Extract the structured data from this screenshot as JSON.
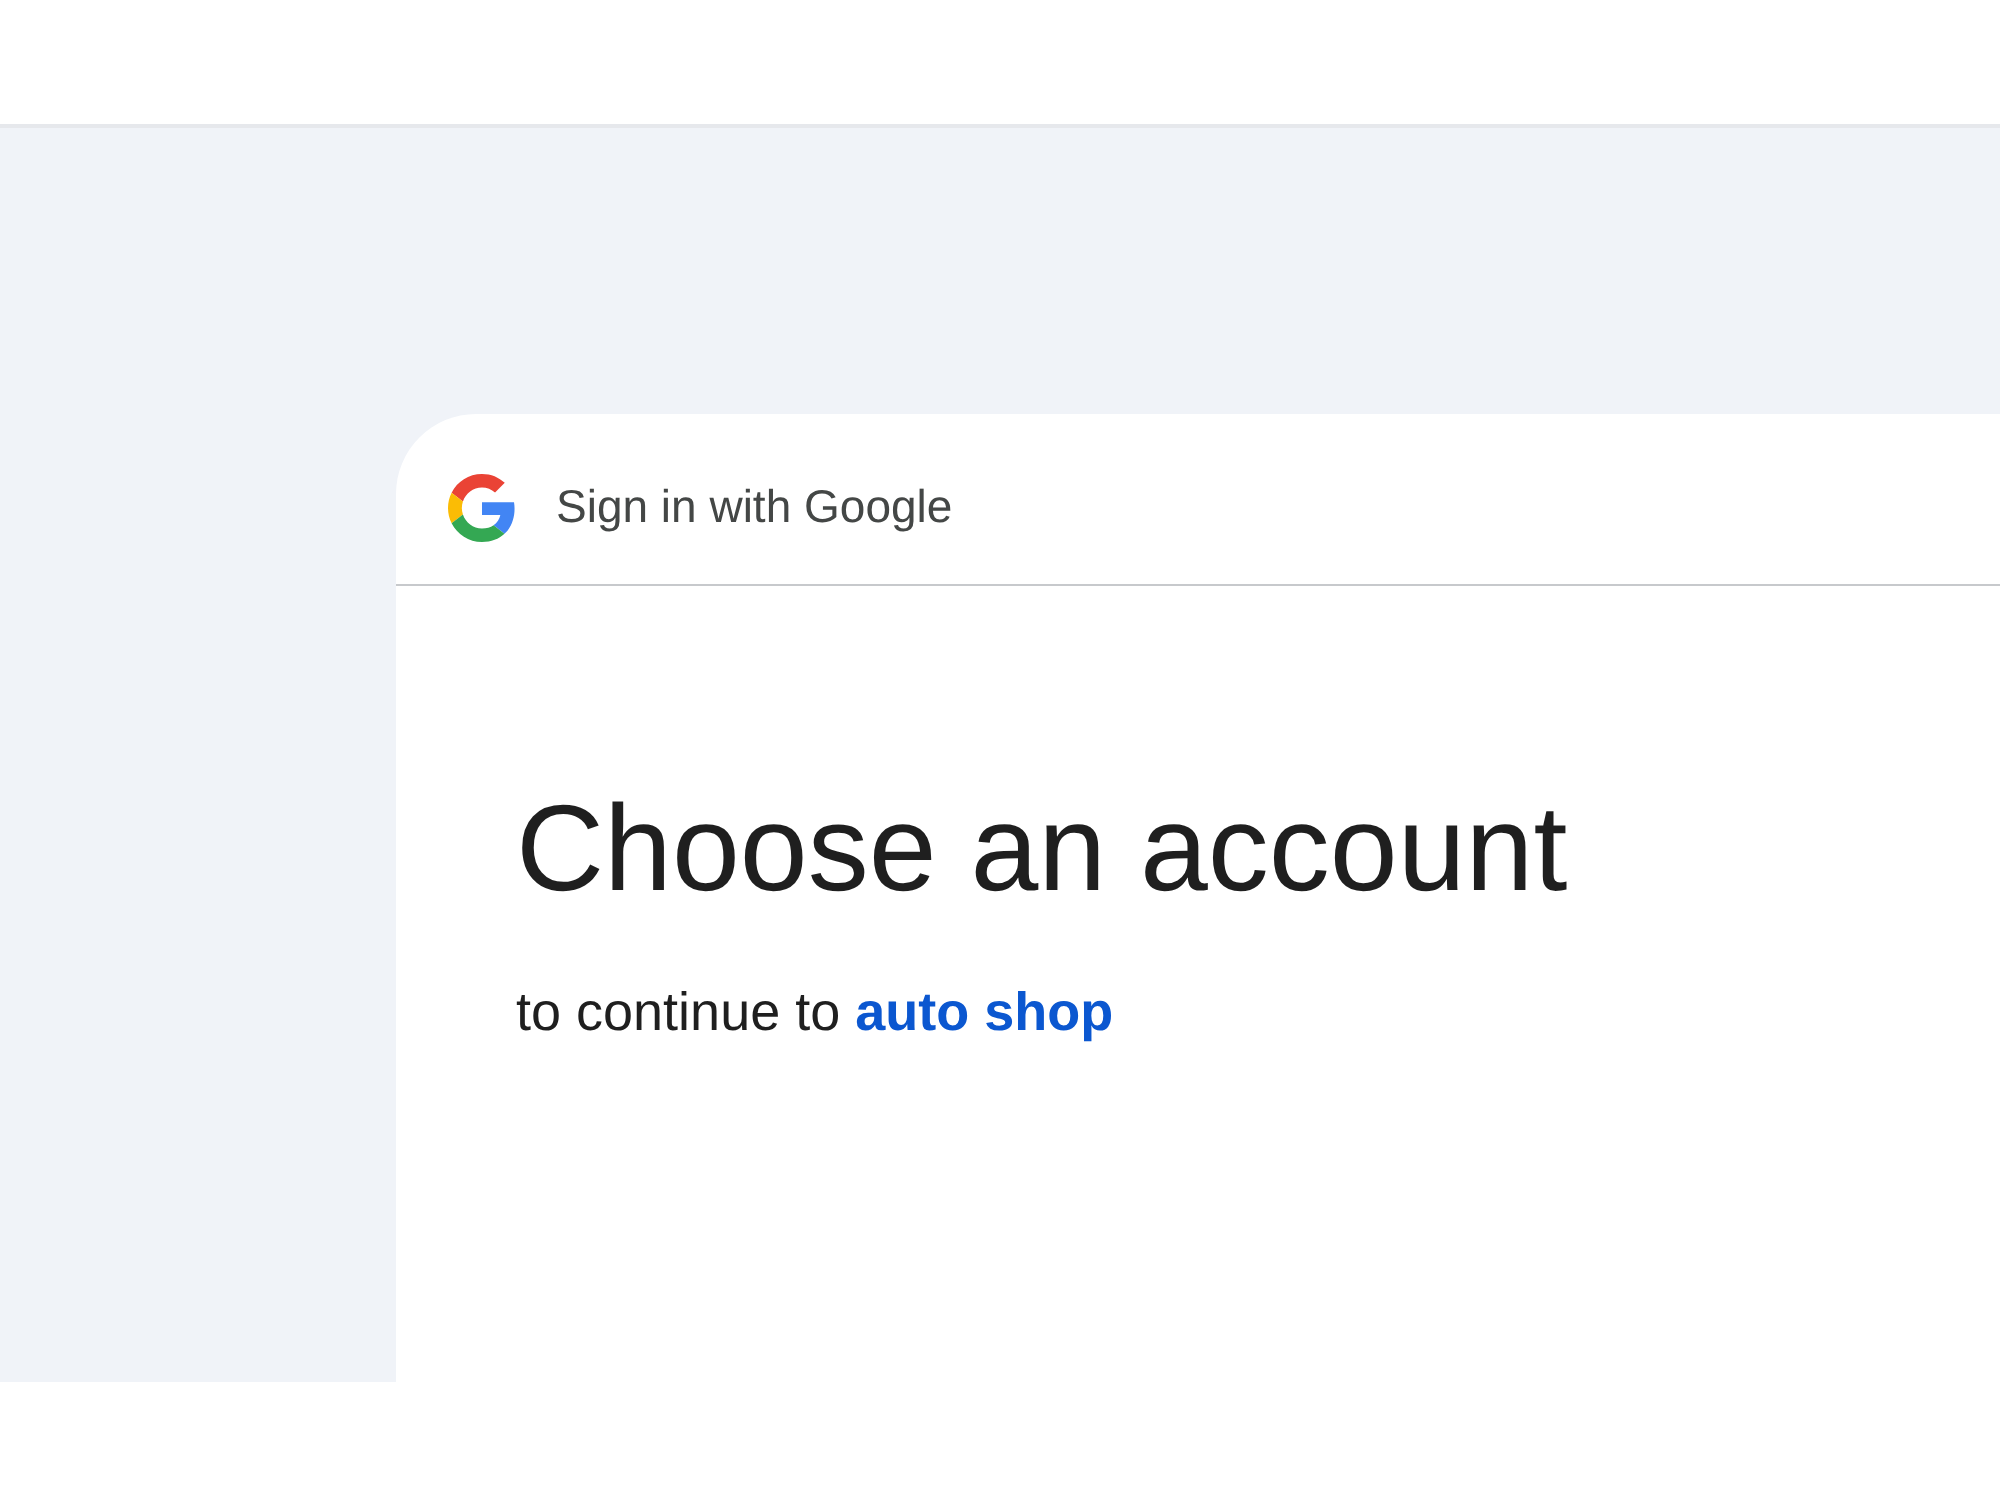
{
  "card": {
    "header": {
      "title": "Sign in with Google"
    },
    "heading": "Choose an account",
    "subtitle": {
      "text": "to continue to",
      "link": "auto shop"
    }
  }
}
